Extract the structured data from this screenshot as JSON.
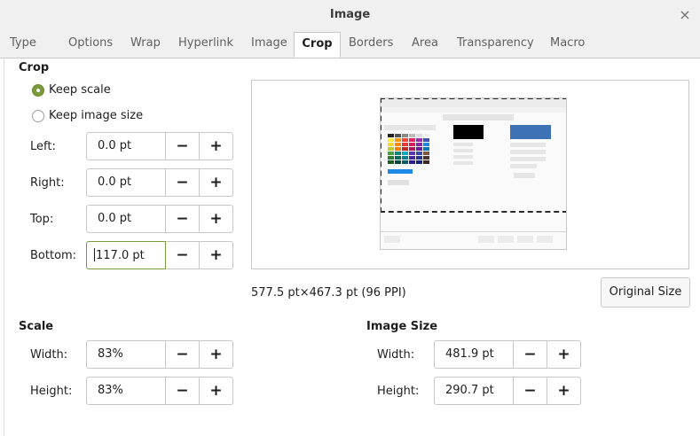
{
  "window": {
    "title": "Image",
    "close_glyph": "×"
  },
  "tabs": [
    {
      "label": "Type"
    },
    {
      "label": "Options"
    },
    {
      "label": "Wrap"
    },
    {
      "label": "Hyperlink"
    },
    {
      "label": "Image"
    },
    {
      "label": "Crop",
      "active": true
    },
    {
      "label": "Borders"
    },
    {
      "label": "Area"
    },
    {
      "label": "Transparency"
    },
    {
      "label": "Macro"
    }
  ],
  "crop": {
    "heading": "Crop",
    "keep_scale": "Keep scale",
    "keep_image_size": "Keep image size",
    "selected_mode": "keep_scale",
    "fields": {
      "left": {
        "label": "Left:",
        "value": "0.0 pt"
      },
      "right": {
        "label": "Right:",
        "value": "0.0 pt"
      },
      "top": {
        "label": "Top:",
        "value": "0.0 pt"
      },
      "bottom": {
        "label": "Bottom:",
        "value": "117.0 pt"
      }
    }
  },
  "preview": {
    "info": "577.5 pt×467.3 pt (96 PPI)",
    "original_size_button": "Original Size"
  },
  "scale": {
    "heading": "Scale",
    "width": {
      "label": "Width:",
      "value": "83%"
    },
    "height": {
      "label": "Height:",
      "value": "83%"
    }
  },
  "image_size": {
    "heading": "Image Size",
    "width": {
      "label": "Width:",
      "value": "481.9 pt"
    },
    "height": {
      "label": "Height:",
      "value": "290.7 pt"
    }
  },
  "spin": {
    "minus": "−",
    "plus": "+"
  },
  "colors": {
    "accent": "#7a9b3b",
    "border": "#c8c8c8",
    "tabbar": "#f0f0f0"
  }
}
